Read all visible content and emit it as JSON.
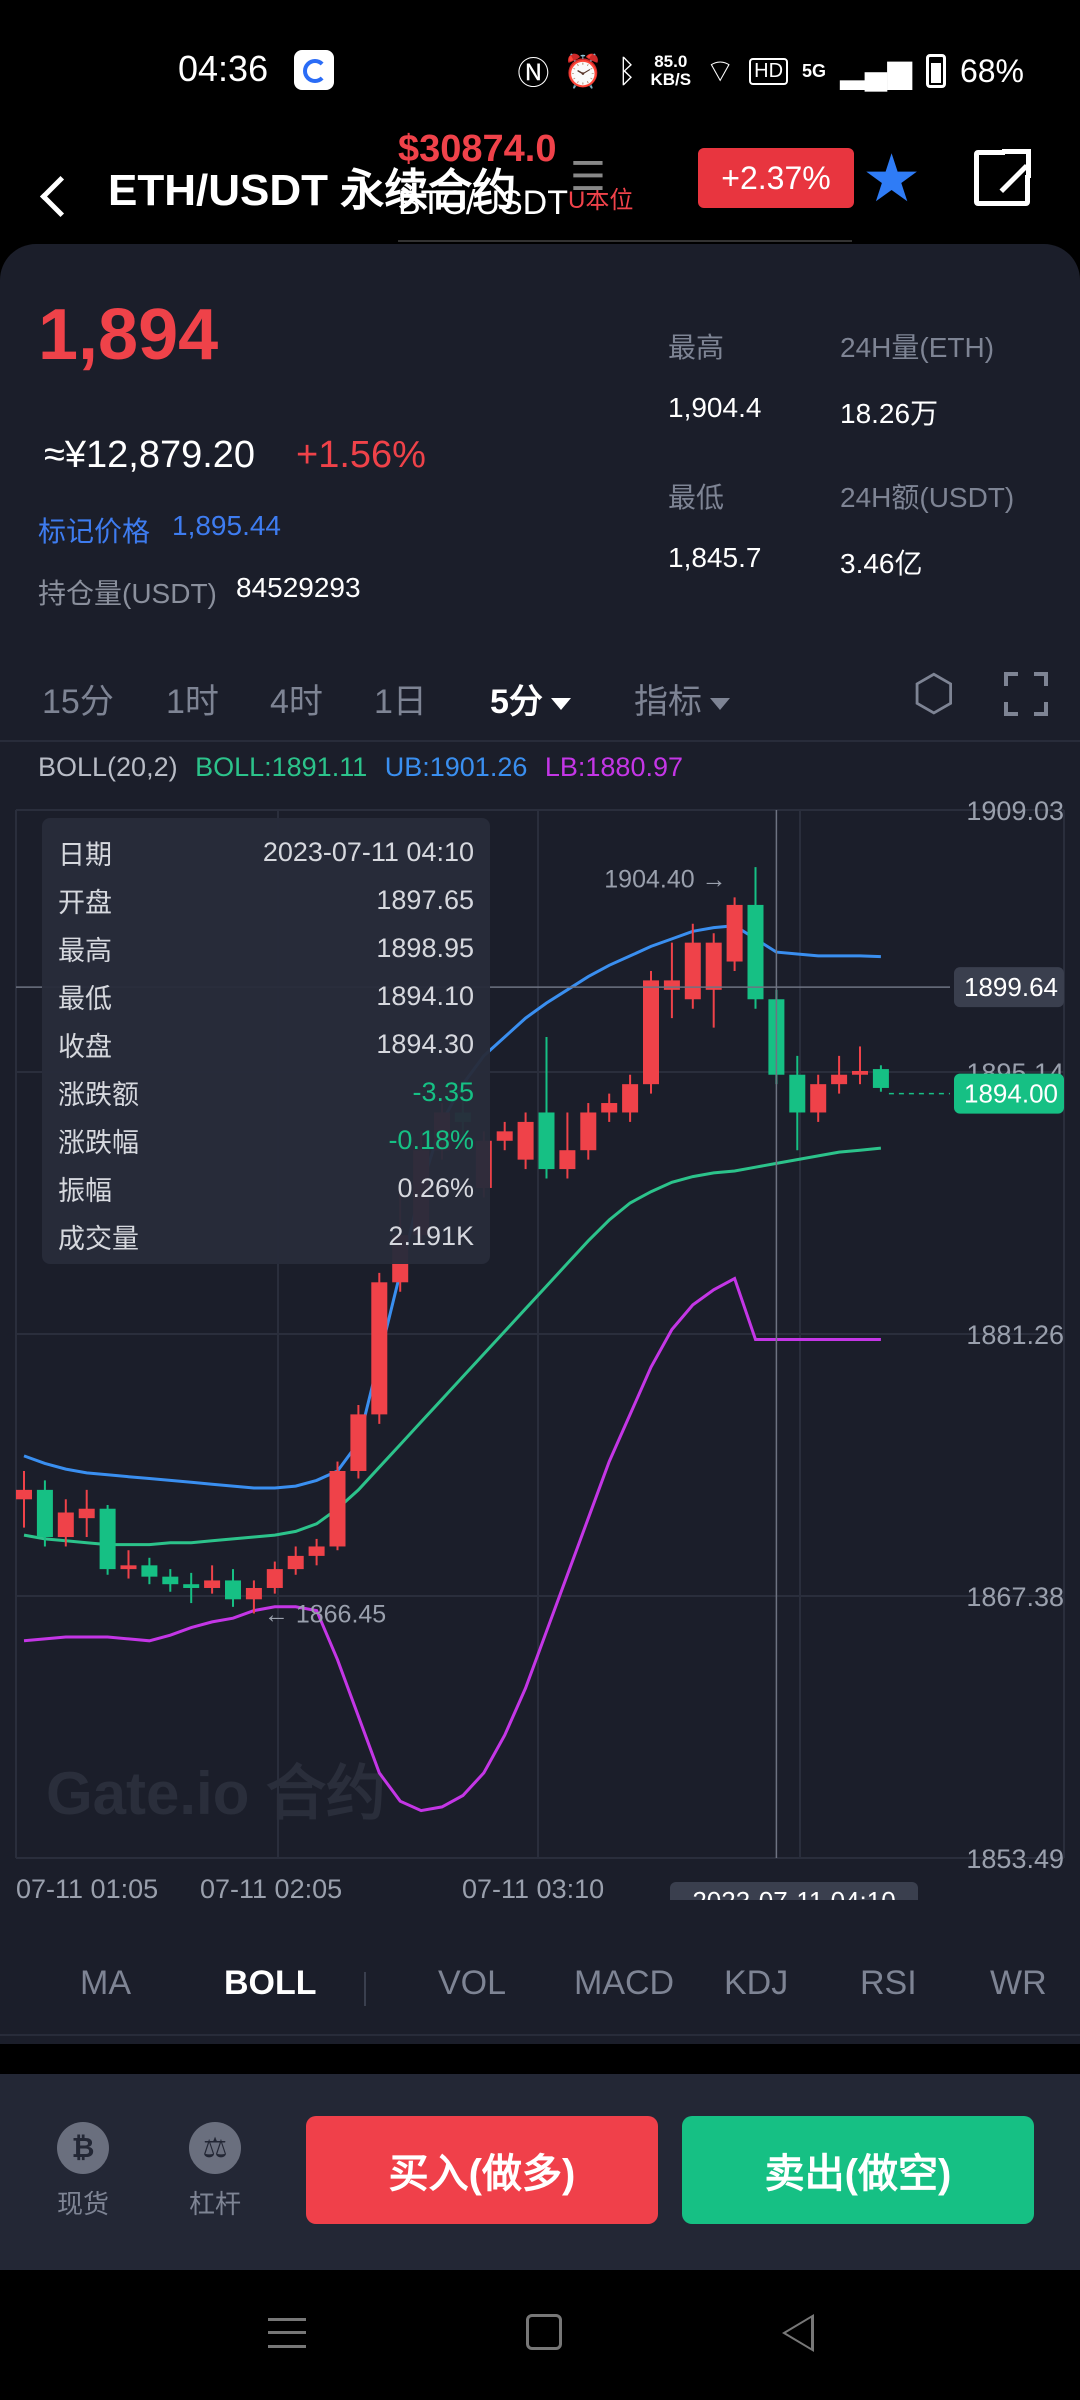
{
  "status_bar": {
    "time": "04:36",
    "net_speed_value": "85.0",
    "net_speed_unit": "KB/S",
    "network": "5G",
    "battery": "68%"
  },
  "header": {
    "pair": "ETH/USDT 永续合约",
    "overlay_price": "$30874.0",
    "overlay_pair": "BTC/USDT",
    "overlay_unit": "U本位",
    "change": "+2.37%"
  },
  "ticker": {
    "last_price": "1,894",
    "cny_price": "≈¥12,879.20",
    "cny_change": "+1.56%",
    "mark_price_label": "标记价格",
    "mark_price_value": "1,895.44",
    "open_interest_label": "持仓量(USDT)",
    "open_interest_value": "84529293",
    "high_label": "最高",
    "high_value": "1,904.4",
    "low_label": "最低",
    "low_value": "1,845.7",
    "vol_label": "24H量(ETH)",
    "vol_value": "18.26万",
    "amount_label": "24H额(USDT)",
    "amount_value": "3.46亿"
  },
  "timeframes": {
    "t15m": "15分",
    "t1h": "1时",
    "t4h": "4时",
    "t1d": "1日",
    "t5m": "5分",
    "indicators": "指标"
  },
  "boll": {
    "name": "BOLL(20,2)",
    "mid": "BOLL:1891.11",
    "ub": "UB:1901.26",
    "lb": "LB:1880.97"
  },
  "tooltip": {
    "rows": [
      {
        "label": "日期",
        "value": "2023-07-11 04:10"
      },
      {
        "label": "开盘",
        "value": "1897.65"
      },
      {
        "label": "最高",
        "value": "1898.95"
      },
      {
        "label": "最低",
        "value": "1894.10"
      },
      {
        "label": "收盘",
        "value": "1894.30"
      },
      {
        "label": "涨跌额",
        "value": "-3.35"
      },
      {
        "label": "涨跌幅",
        "value": "-0.18%"
      },
      {
        "label": "振幅",
        "value": "0.26%"
      },
      {
        "label": "成交量",
        "value": "2.191K"
      }
    ]
  },
  "chart": {
    "y_ticks": [
      "1909.03",
      "1895.14",
      "1881.26",
      "1867.38",
      "1853.49"
    ],
    "x_ticks": [
      "07-11 01:05",
      "07-11 02:05",
      "07-11 03:10"
    ],
    "crosshair_time": "2023-07-11 04:10",
    "crosshair_price": "1899.64",
    "last_price_tag": "1894.00",
    "max_label": "1904.40 →",
    "min_label": "← 1866.45",
    "watermark": "Gate.io 合约"
  },
  "chart_data": {
    "type": "candlestick",
    "ylim": [
      1853.49,
      1909.03
    ],
    "candles": [
      {
        "o": 1872.5,
        "c": 1873.0,
        "h": 1874.0,
        "l": 1871.0
      },
      {
        "o": 1873.0,
        "c": 1870.5,
        "h": 1873.5,
        "l": 1870.0
      },
      {
        "o": 1870.5,
        "c": 1871.8,
        "h": 1872.5,
        "l": 1870.0
      },
      {
        "o": 1871.5,
        "c": 1872.0,
        "h": 1873.0,
        "l": 1870.5
      },
      {
        "o": 1872.0,
        "c": 1868.8,
        "h": 1872.2,
        "l": 1868.5
      },
      {
        "o": 1868.8,
        "c": 1869.0,
        "h": 1869.8,
        "l": 1868.3
      },
      {
        "o": 1869.0,
        "c": 1868.4,
        "h": 1869.4,
        "l": 1868.0
      },
      {
        "o": 1868.4,
        "c": 1868.0,
        "h": 1868.8,
        "l": 1867.6
      },
      {
        "o": 1868.0,
        "c": 1867.8,
        "h": 1868.6,
        "l": 1867.0
      },
      {
        "o": 1867.8,
        "c": 1868.2,
        "h": 1869.0,
        "l": 1867.5
      },
      {
        "o": 1868.2,
        "c": 1867.2,
        "h": 1868.8,
        "l": 1866.8
      },
      {
        "o": 1867.2,
        "c": 1867.8,
        "h": 1868.2,
        "l": 1866.45
      },
      {
        "o": 1867.8,
        "c": 1868.8,
        "h": 1869.2,
        "l": 1867.5
      },
      {
        "o": 1868.8,
        "c": 1869.5,
        "h": 1870.0,
        "l": 1868.5
      },
      {
        "o": 1869.5,
        "c": 1870.0,
        "h": 1870.4,
        "l": 1869.0
      },
      {
        "o": 1870.0,
        "c": 1874.0,
        "h": 1874.5,
        "l": 1869.8
      },
      {
        "o": 1874.0,
        "c": 1877.0,
        "h": 1877.5,
        "l": 1873.6
      },
      {
        "o": 1877.0,
        "c": 1884.0,
        "h": 1884.5,
        "l": 1876.5
      },
      {
        "o": 1884.0,
        "c": 1886.5,
        "h": 1889.0,
        "l": 1883.5
      },
      {
        "o": 1886.5,
        "c": 1891.0,
        "h": 1892.0,
        "l": 1886.0
      },
      {
        "o": 1891.0,
        "c": 1893.0,
        "h": 1893.5,
        "l": 1890.5
      },
      {
        "o": 1893.0,
        "c": 1892.5,
        "h": 1894.5,
        "l": 1891.5
      },
      {
        "o": 1889.0,
        "c": 1891.5,
        "h": 1892.0,
        "l": 1888.5
      },
      {
        "o": 1891.5,
        "c": 1892.0,
        "h": 1892.5,
        "l": 1891.0
      },
      {
        "o": 1890.5,
        "c": 1892.5,
        "h": 1893.0,
        "l": 1890.0
      },
      {
        "o": 1893.0,
        "c": 1890.0,
        "h": 1897.0,
        "l": 1889.5
      },
      {
        "o": 1890.0,
        "c": 1891.0,
        "h": 1893.0,
        "l": 1889.5
      },
      {
        "o": 1891.0,
        "c": 1893.0,
        "h": 1893.5,
        "l": 1890.5
      },
      {
        "o": 1893.0,
        "c": 1893.5,
        "h": 1894.0,
        "l": 1892.5
      },
      {
        "o": 1893.0,
        "c": 1894.5,
        "h": 1895.0,
        "l": 1892.5
      },
      {
        "o": 1894.5,
        "c": 1900.0,
        "h": 1900.5,
        "l": 1894.0
      },
      {
        "o": 1899.5,
        "c": 1900.0,
        "h": 1902.0,
        "l": 1898.0
      },
      {
        "o": 1899.0,
        "c": 1902.0,
        "h": 1903.0,
        "l": 1898.5
      },
      {
        "o": 1899.5,
        "c": 1902.0,
        "h": 1902.5,
        "l": 1897.5
      },
      {
        "o": 1901.0,
        "c": 1904.0,
        "h": 1904.4,
        "l": 1900.5
      },
      {
        "o": 1904.0,
        "c": 1899.0,
        "h": 1906.0,
        "l": 1898.5
      },
      {
        "o": 1899.0,
        "c": 1895.0,
        "h": 1899.5,
        "l": 1894.5
      },
      {
        "o": 1895.0,
        "c": 1893.0,
        "h": 1896.0,
        "l": 1891.0
      },
      {
        "o": 1893.0,
        "c": 1894.5,
        "h": 1895.0,
        "l": 1892.5
      },
      {
        "o": 1894.5,
        "c": 1895.0,
        "h": 1896.0,
        "l": 1894.0
      },
      {
        "o": 1895.0,
        "c": 1895.2,
        "h": 1896.5,
        "l": 1894.5
      },
      {
        "o": 1895.3,
        "c": 1894.3,
        "h": 1895.5,
        "l": 1894.1
      }
    ],
    "ub": [
      1874.8,
      1874.4,
      1874.1,
      1873.9,
      1873.8,
      1873.7,
      1873.6,
      1873.5,
      1873.4,
      1873.3,
      1873.2,
      1873.1,
      1873.1,
      1873.2,
      1873.5,
      1874.0,
      1875.5,
      1880.0,
      1884.5,
      1889.0,
      1892.5,
      1894.5,
      1896.0,
      1897.0,
      1898.0,
      1898.8,
      1899.5,
      1900.2,
      1900.8,
      1901.3,
      1901.8,
      1902.2,
      1902.6,
      1902.8,
      1902.9,
      1902.2,
      1901.5,
      1901.4,
      1901.3,
      1901.3,
      1901.3,
      1901.26
    ],
    "mid": [
      1870.6,
      1870.4,
      1870.3,
      1870.2,
      1870.1,
      1870.1,
      1870.1,
      1870.2,
      1870.2,
      1870.3,
      1870.4,
      1870.5,
      1870.6,
      1870.8,
      1871.2,
      1872.0,
      1873.0,
      1874.2,
      1875.4,
      1876.6,
      1877.8,
      1879.0,
      1880.2,
      1881.4,
      1882.6,
      1883.8,
      1885.0,
      1886.2,
      1887.3,
      1888.2,
      1888.8,
      1889.3,
      1889.6,
      1889.8,
      1889.9,
      1890.1,
      1890.3,
      1890.5,
      1890.7,
      1890.9,
      1891.0,
      1891.11
    ],
    "lb": [
      1865.0,
      1865.1,
      1865.2,
      1865.2,
      1865.2,
      1865.1,
      1865.0,
      1865.3,
      1865.7,
      1866.0,
      1866.2,
      1866.6,
      1866.8,
      1866.8,
      1866.6,
      1864.0,
      1861.0,
      1858.0,
      1856.5,
      1856.0,
      1856.2,
      1856.8,
      1858.0,
      1860.0,
      1862.5,
      1865.5,
      1868.5,
      1871.5,
      1874.5,
      1877.0,
      1879.5,
      1881.5,
      1882.8,
      1883.6,
      1884.2,
      1880.97,
      1880.97,
      1880.97,
      1880.97,
      1880.97,
      1880.97,
      1880.97
    ],
    "colors": {
      "up": "#ef4249",
      "down": "#16c084",
      "ub": "#3a8ff0",
      "mid": "#2cc38b",
      "lb": "#c436e6"
    }
  },
  "indicator_tabs": [
    "MA",
    "BOLL",
    "VOL",
    "MACD",
    "KDJ",
    "RSI",
    "WR"
  ],
  "bottom": {
    "spot": "现货",
    "leverage": "杠杆",
    "buy": "买入(做多)",
    "sell": "卖出(做空)"
  }
}
